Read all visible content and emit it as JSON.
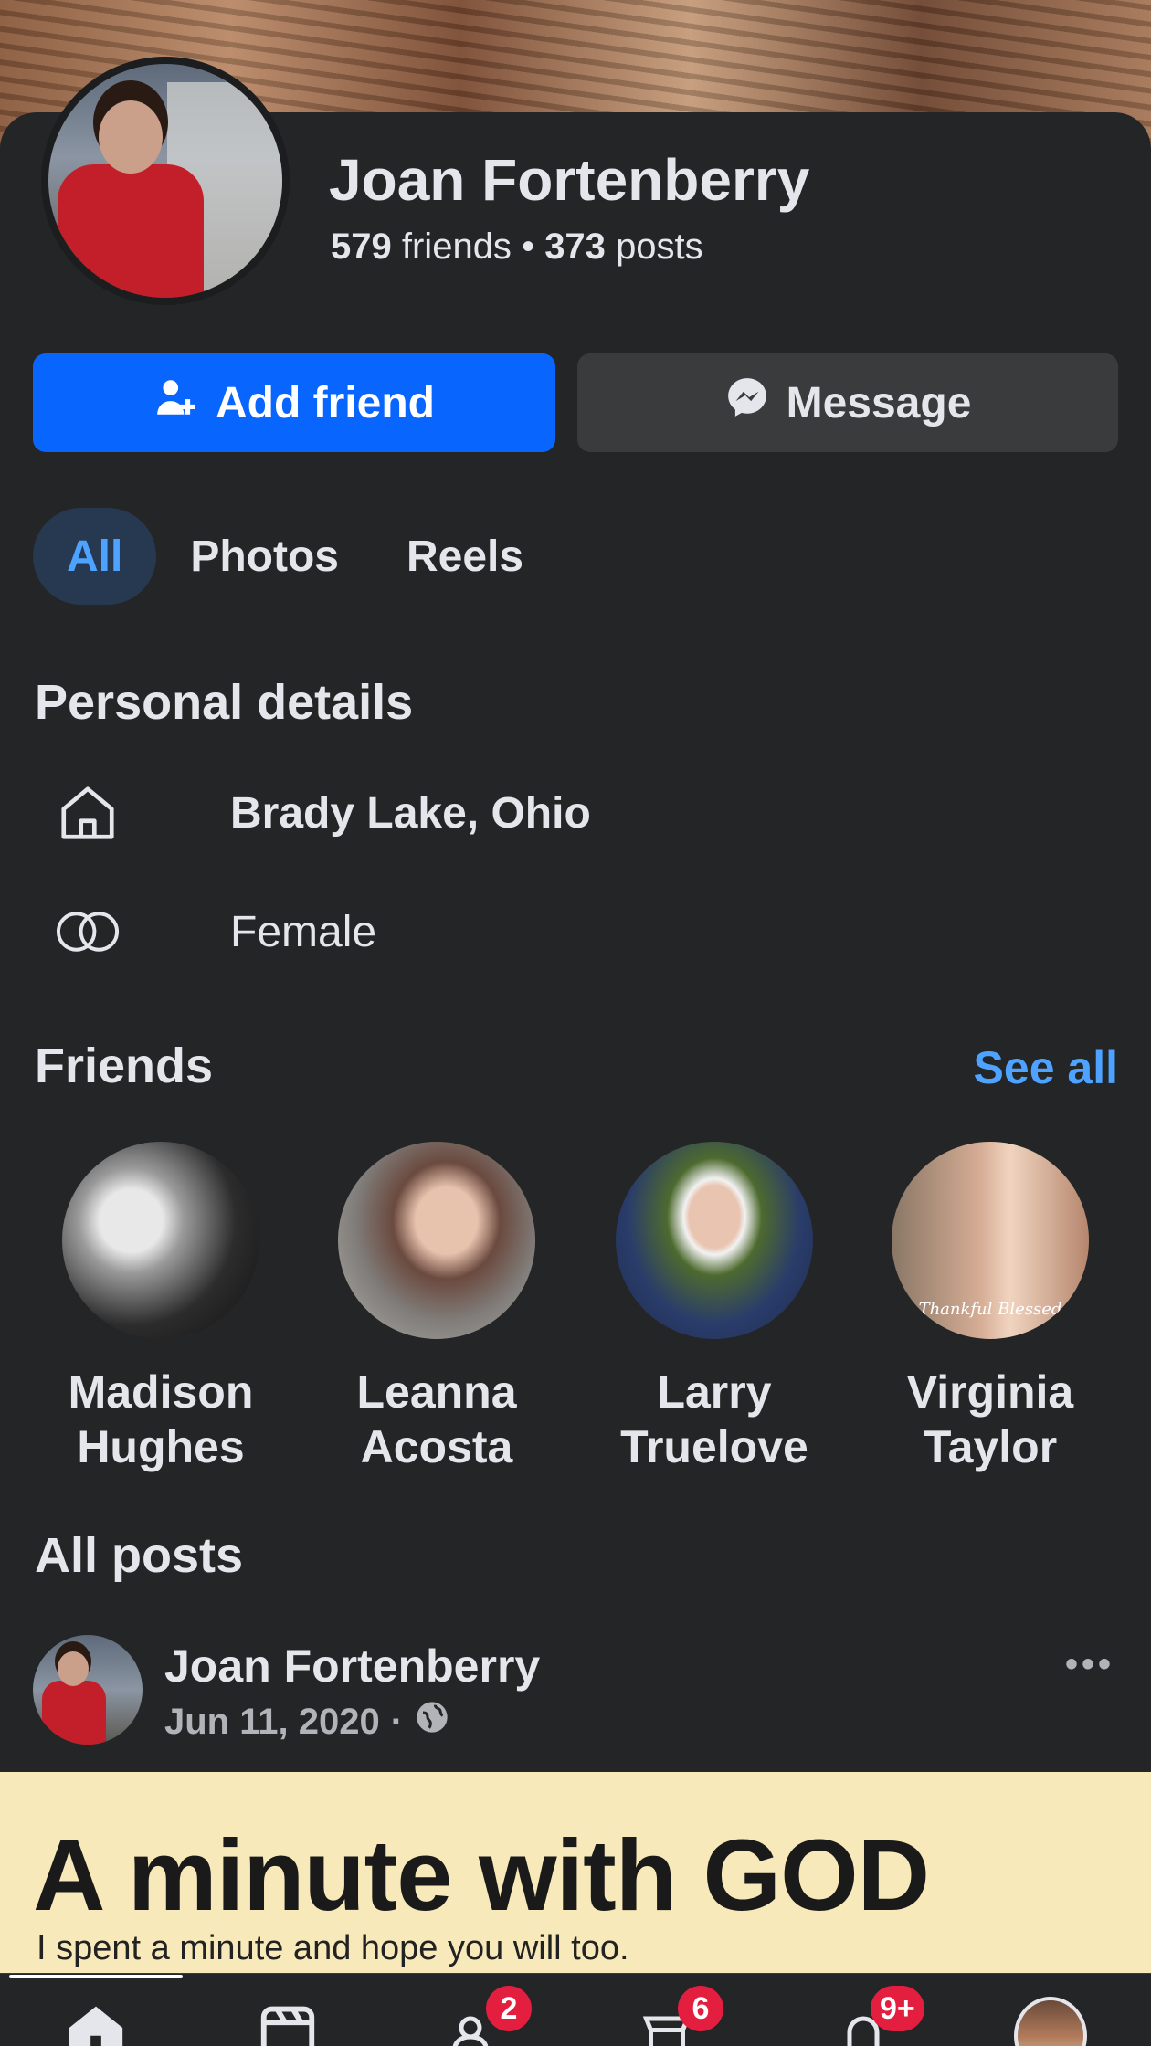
{
  "profile": {
    "name": "Joan Fortenberry",
    "friends_count": "579",
    "friends_label": "friends",
    "posts_count": "373",
    "posts_label": "posts"
  },
  "actions": {
    "add_friend": "Add friend",
    "message": "Message"
  },
  "tabs": [
    {
      "label": "All",
      "active": true
    },
    {
      "label": "Photos",
      "active": false
    },
    {
      "label": "Reels",
      "active": false
    }
  ],
  "personal_details": {
    "title": "Personal details",
    "location": "Brady Lake, Ohio",
    "gender": "Female"
  },
  "friends": {
    "title": "Friends",
    "see_all": "See all",
    "items": [
      {
        "first": "Madison",
        "last": "Hughes"
      },
      {
        "first": "Leanna",
        "last": "Acosta"
      },
      {
        "first": "Larry",
        "last": "Truelove"
      },
      {
        "first": "Virginia",
        "last": "Taylor"
      }
    ],
    "overlay_text": "Thankful Blessed"
  },
  "posts": {
    "title": "All posts",
    "first": {
      "author": "Joan Fortenberry",
      "date": "Jun 11, 2020",
      "image_headline": "A minute with GOD",
      "image_sub": "I spent a minute and hope you will too."
    }
  },
  "bottom_nav": {
    "badges": {
      "friends": "2",
      "marketplace": "6",
      "notifications": "9+"
    }
  },
  "colors": {
    "accent": "#0866ff",
    "link": "#4da3ff",
    "badge": "#e41e3f",
    "bg": "#242526"
  }
}
